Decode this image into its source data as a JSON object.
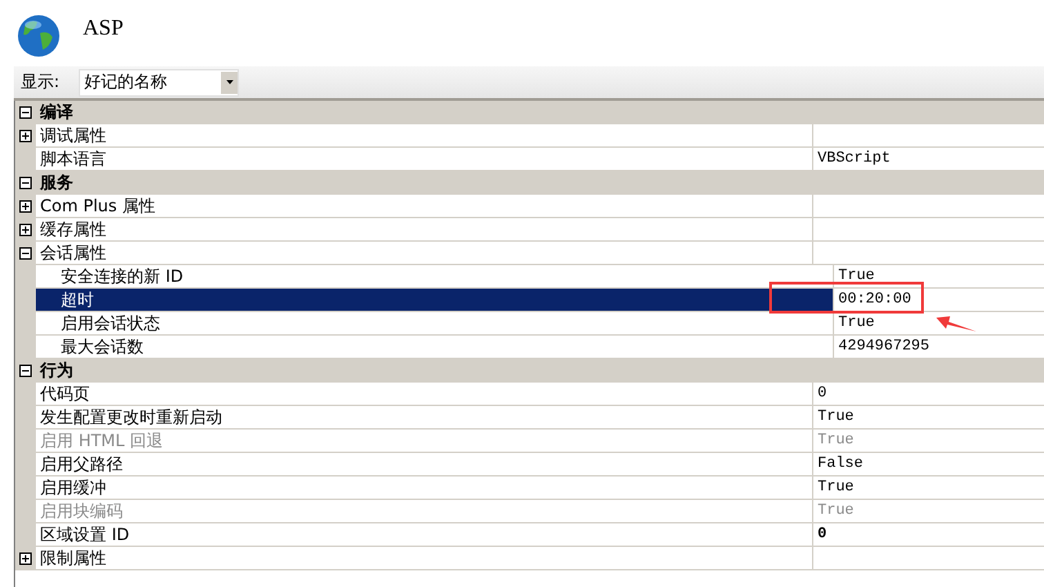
{
  "header": {
    "title": "ASP"
  },
  "toolbar": {
    "label": "显示:",
    "dropdown": {
      "value": "好记的名称"
    }
  },
  "grid": {
    "rows": [
      {
        "kind": "category",
        "name": "编译",
        "expanded": true,
        "children": [
          {
            "kind": "property",
            "name": "调试属性",
            "expanded": false
          },
          {
            "kind": "property",
            "name": "脚本语言",
            "value": "VBScript"
          }
        ]
      },
      {
        "kind": "category",
        "name": "服务",
        "expanded": true,
        "children": [
          {
            "kind": "property",
            "name": "Com Plus 属性",
            "expanded": false
          },
          {
            "kind": "property",
            "name": "缓存属性",
            "expanded": false
          },
          {
            "kind": "property",
            "name": "会话属性",
            "expanded": true,
            "children": [
              {
                "kind": "property",
                "name": "安全连接的新 ID",
                "value": "True"
              },
              {
                "kind": "property",
                "name": "超时",
                "value": "00:20:00",
                "selected": true
              },
              {
                "kind": "property",
                "name": "启用会话状态",
                "value": "True"
              },
              {
                "kind": "property",
                "name": "最大会话数",
                "value": "4294967295"
              }
            ]
          }
        ]
      },
      {
        "kind": "category",
        "name": "行为",
        "expanded": true,
        "children": [
          {
            "kind": "property",
            "name": "代码页",
            "value": "0"
          },
          {
            "kind": "property",
            "name": "发生配置更改时重新启动",
            "value": "True"
          },
          {
            "kind": "property",
            "name": "启用 HTML 回退",
            "value": "True",
            "disabled": true
          },
          {
            "kind": "property",
            "name": "启用父路径",
            "value": "False"
          },
          {
            "kind": "property",
            "name": "启用缓冲",
            "value": "True"
          },
          {
            "kind": "property",
            "name": "启用块编码",
            "value": "True",
            "disabled": true
          },
          {
            "kind": "property",
            "name": "区域设置 ID",
            "value": "0",
            "modified": true
          },
          {
            "kind": "property",
            "name": "限制属性",
            "expanded": false
          }
        ]
      }
    ]
  },
  "annotation": {
    "kind": "highlight-arrow"
  }
}
